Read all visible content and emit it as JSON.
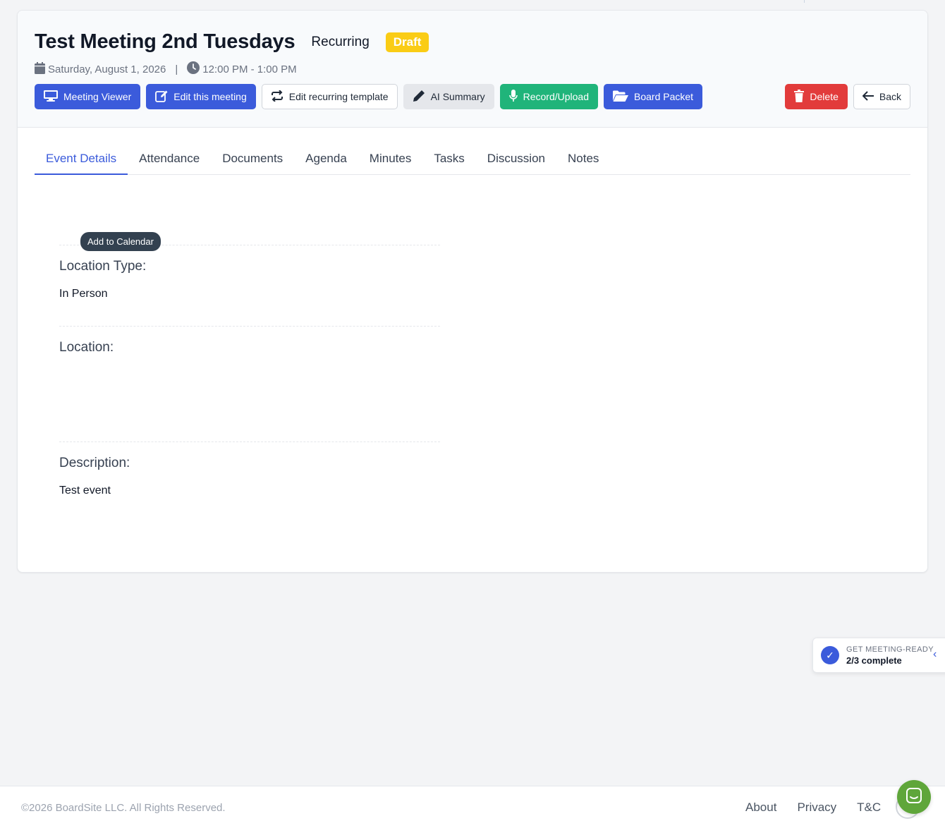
{
  "meeting": {
    "title": "Test Meeting 2nd Tuesdays",
    "recurring_label": "Recurring",
    "status_badge": "Draft",
    "date": "Saturday, August 1, 2026",
    "separator": "|",
    "time": "12:00 PM - 1:00 PM"
  },
  "toolbar": {
    "meeting_viewer": "Meeting Viewer",
    "edit_meeting": "Edit this meeting",
    "edit_recurring": "Edit recurring template",
    "ai_summary": "AI Summary",
    "record_upload": "Record/Upload",
    "board_packet": "Board Packet",
    "delete": "Delete",
    "back": "Back"
  },
  "tabs": [
    {
      "label": "Event Details",
      "active": true
    },
    {
      "label": "Attendance"
    },
    {
      "label": "Documents"
    },
    {
      "label": "Agenda"
    },
    {
      "label": "Minutes"
    },
    {
      "label": "Tasks"
    },
    {
      "label": "Discussion"
    },
    {
      "label": "Notes"
    }
  ],
  "details": {
    "add_to_calendar": "Add to Calendar",
    "location_type_label": "Location Type:",
    "location_type_value": "In Person",
    "location_label": "Location:",
    "location_value": "",
    "description_label": "Description:",
    "description_value": "Test event"
  },
  "checklist": {
    "title": "GET MEETING-READY",
    "progress": "2/3 complete"
  },
  "footer": {
    "copyright": "©2026 BoardSite LLC. All Rights Reserved.",
    "links": [
      "About",
      "Privacy",
      "T&C"
    ]
  },
  "colors": {
    "primary": "#3b5bdb",
    "success": "#20b47a",
    "danger": "#e23b3b",
    "draft": "#facc15"
  }
}
